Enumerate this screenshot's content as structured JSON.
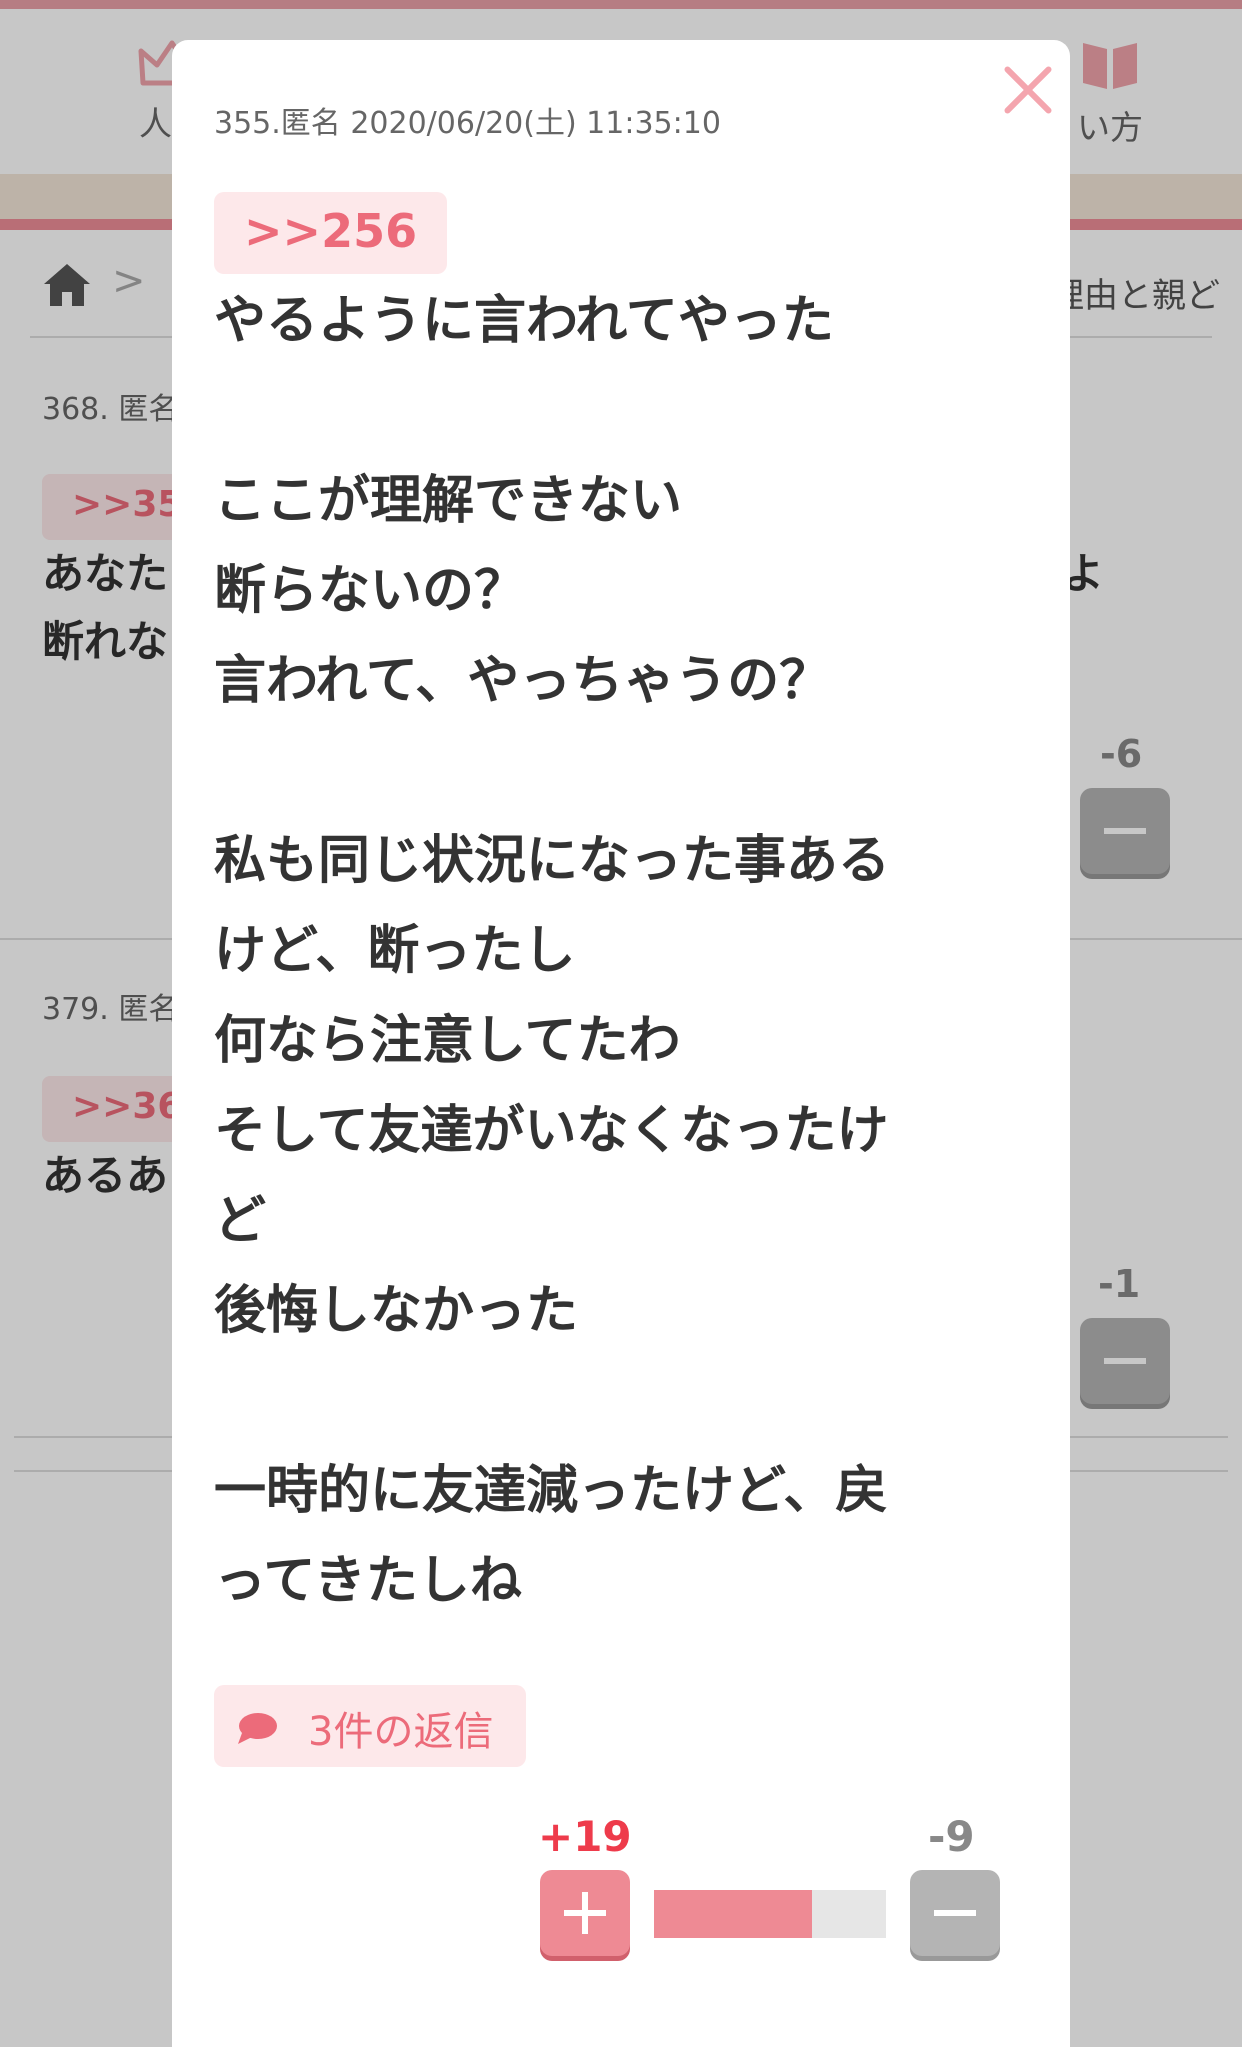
{
  "nav": {
    "left_label": "人気",
    "right_label": "い方"
  },
  "breadcrumb": {
    "separator": ">",
    "partial_title": "理由と親ど"
  },
  "background_comments": [
    {
      "header": "368. 匿名",
      "anchor": ">>35",
      "lines": [
        "あなた",
        "断れな"
      ],
      "line_tail": "よ",
      "score": "-6"
    },
    {
      "header": "379. 匿名",
      "anchor": ">>36",
      "lines": [
        "あるあ"
      ],
      "score": "-1"
    }
  ],
  "modal": {
    "header": "355.匿名 2020/06/20(土) 11:35:10",
    "anchor": ">>256",
    "body_lines": [
      "やるように言われてやった",
      "",
      "ここが理解できない",
      "断らないの？",
      "言われて、やっちゃうの？",
      "",
      "私も同じ状況になった事ある",
      "けど、断ったし",
      "何なら注意してたわ",
      "そして友達がいなくなったけ",
      "ど",
      "後悔しなかった",
      "",
      "一時的に友達減ったけど、戻",
      "ってきたしね"
    ],
    "reply_button": "3件の返信",
    "plus_score": "+19",
    "minus_score": "-9",
    "plus_share": 0.68
  },
  "colors": {
    "accent_pink": "#ee8a94",
    "anchor_text": "#ec6b7a",
    "plus_score": "#ee3b4b",
    "minus_button": "#b4b4b4"
  },
  "icons": [
    "crown-icon",
    "book-icon",
    "home-icon",
    "chevron-right-icon",
    "close-icon",
    "speech-bubble-icon",
    "plus-icon",
    "minus-icon"
  ]
}
